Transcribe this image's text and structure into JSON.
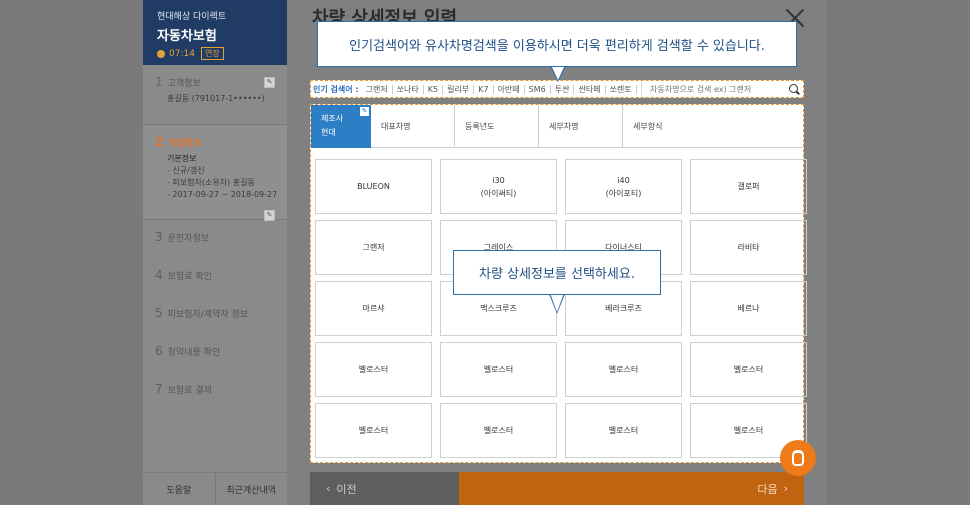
{
  "sidebar": {
    "brand_name": "현대해상 다이렉트",
    "brand_title": "자동차보험",
    "timer": "07:14",
    "extend_label": "연장",
    "steps": [
      {
        "num": "1",
        "label": "고객정보",
        "sub": "홍길동 (791017-1••••••)"
      },
      {
        "num": "2",
        "label": "차량정보",
        "sub_title": "기본정보",
        "sub_lines": "- 신규/갱신\n- 피보험자(소유자) 홍길동\n- 2017-09-27 ~ 2018-09-27"
      },
      {
        "num": "3",
        "label": "운전자정보"
      },
      {
        "num": "4",
        "label": "보험료 확인"
      },
      {
        "num": "5",
        "label": "피보험자/계약자 정보"
      },
      {
        "num": "6",
        "label": "청약내용 확인"
      },
      {
        "num": "7",
        "label": "보험료 결제"
      }
    ],
    "bottom": {
      "help": "도움말",
      "recent": "최근계산내역"
    }
  },
  "main": {
    "title": "차량 상세정보 입력",
    "popular_label": "인기 검색어 :",
    "popular_items": [
      "그랜저",
      "쏘나타",
      "K5",
      "릴리부",
      "K7",
      "아반떼",
      "SM6",
      "투싼",
      "싼타페",
      "쏘렌토"
    ],
    "search_placeholder": "자동차명으로 검색 ex) 그랜저",
    "maker_label": "제조사",
    "maker_value": "현대",
    "tabs": [
      "대표차명",
      "등록년도",
      "세부차명",
      "세부항식"
    ],
    "cells": [
      "BLUEON",
      "i30\n(아이써티)",
      "i40\n(아이포티)",
      "갤로퍼",
      "그랜저",
      "그레이스",
      "다이너스티",
      "라비타",
      "마르샤",
      "맥스크루즈",
      "베라크루즈",
      "베르나",
      "벨로스터",
      "벨로스터",
      "벨로스터",
      "벨로스터",
      "벨로스터",
      "벨로스터",
      "벨로스터",
      "벨로스터"
    ],
    "prev_label": "이전",
    "next_label": "다음"
  },
  "tooltips": {
    "search_tip": "인기검색어와 유사차명검색을 이용하시면 더욱 편리하게 검색할 수 있습니다.",
    "select_tip": "차량 상세정보를 선택하세요."
  }
}
